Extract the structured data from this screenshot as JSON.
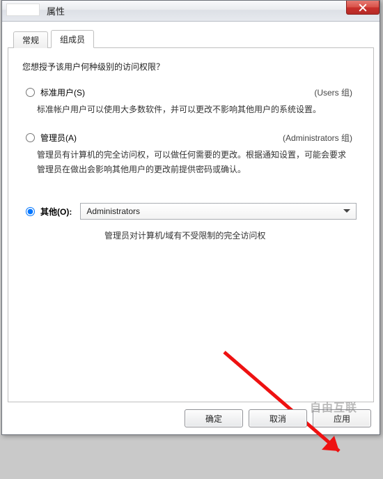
{
  "window": {
    "title_suffix": "属性"
  },
  "titlebar": {
    "close_tooltip": "关闭"
  },
  "tabs": {
    "general": "常规",
    "members": "组成员"
  },
  "page": {
    "prompt": "您想授予该用户何种级别的访问权限？",
    "standard": {
      "label": "标准用户(S)",
      "group": "(Users 组)",
      "desc": "标准帐户用户可以使用大多数软件，并可以更改不影响其他用户的系统设置。"
    },
    "admin": {
      "label": "管理员(A)",
      "group": "(Administrators 组)",
      "desc": "管理员有计算机的完全访问权，可以做任何需要的更改。根据通知设置，可能会要求管理员在做出会影响其他用户的更改前提供密码或确认。"
    },
    "other": {
      "label": "其他(O):",
      "selected": "Administrators",
      "desc": "管理员对计算机/域有不受限制的完全访问权"
    }
  },
  "buttons": {
    "ok": "确定",
    "cancel": "取消",
    "apply": "应用"
  },
  "watermark": "自由互联"
}
